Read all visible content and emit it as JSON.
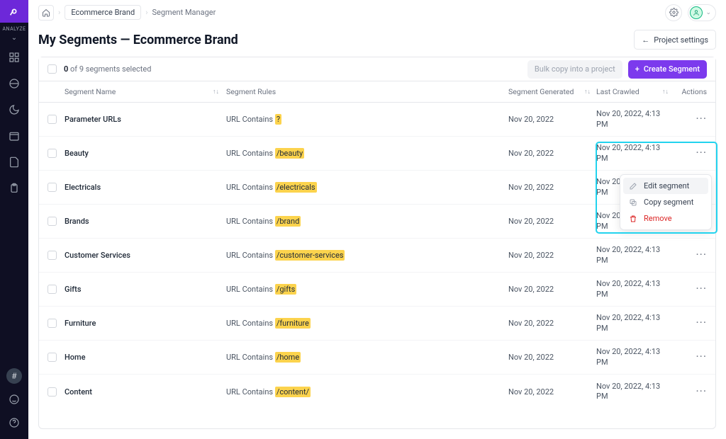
{
  "sidebar": {
    "section_label": "ANALYZE"
  },
  "breadcrumb": {
    "project": "Ecommerce Brand",
    "page": "Segment Manager"
  },
  "page": {
    "title": "My Segments — Ecommerce Brand",
    "project_settings_label": "Project settings"
  },
  "toolbar": {
    "selected_count": "0",
    "total_count": "9",
    "selected_suffix": " segments selected",
    "bulk_copy_label": "Bulk copy into a project",
    "create_label": "Create Segment"
  },
  "columns": {
    "name": "Segment Name",
    "rules": "Segment Rules",
    "generated": "Segment Generated",
    "crawled": "Last Crawled",
    "actions": "Actions"
  },
  "rows": [
    {
      "name": "Parameter URLs",
      "rule_prefix": "URL Contains ",
      "rule_hl": "?",
      "generated": "Nov 20, 2022",
      "crawled": "Nov 20, 2022, 4:13 PM"
    },
    {
      "name": "Beauty",
      "rule_prefix": "URL Contains ",
      "rule_hl": "/beauty",
      "generated": "Nov 20, 2022",
      "crawled": "Nov 20, 2022, 4:13 PM"
    },
    {
      "name": "Electricals",
      "rule_prefix": "URL Contains ",
      "rule_hl": "/electricals",
      "generated": "Nov 20, 2022",
      "crawled": "Nov 20, 2022, 4:13 PM"
    },
    {
      "name": "Brands",
      "rule_prefix": "URL Contains ",
      "rule_hl": "/brand",
      "generated": "Nov 20, 2022",
      "crawled": "Nov 20, 2022, 4:13 PM"
    },
    {
      "name": "Customer Services",
      "rule_prefix": "URL Contains ",
      "rule_hl": "/customer-services",
      "generated": "Nov 20, 2022",
      "crawled": "Nov 20, 2022, 4:13 PM"
    },
    {
      "name": "Gifts",
      "rule_prefix": "URL Contains ",
      "rule_hl": "/gifts",
      "generated": "Nov 20, 2022",
      "crawled": "Nov 20, 2022, 4:13 PM"
    },
    {
      "name": "Furniture",
      "rule_prefix": "URL Contains ",
      "rule_hl": "/furniture",
      "generated": "Nov 20, 2022",
      "crawled": "Nov 20, 2022, 4:13 PM"
    },
    {
      "name": "Home",
      "rule_prefix": "URL Contains ",
      "rule_hl": "/home",
      "generated": "Nov 20, 2022",
      "crawled": "Nov 20, 2022, 4:13 PM"
    },
    {
      "name": "Content",
      "rule_prefix": "URL Contains ",
      "rule_hl": "/content/",
      "generated": "Nov 20, 2022",
      "crawled": "Nov 20, 2022, 4:13 PM"
    }
  ],
  "popover": {
    "edit": "Edit segment",
    "copy": "Copy segment",
    "remove": "Remove"
  },
  "colors": {
    "accent": "#7c3aed",
    "highlight": "#fcd34d",
    "callout": "#22d3ee",
    "danger": "#dc2626"
  }
}
